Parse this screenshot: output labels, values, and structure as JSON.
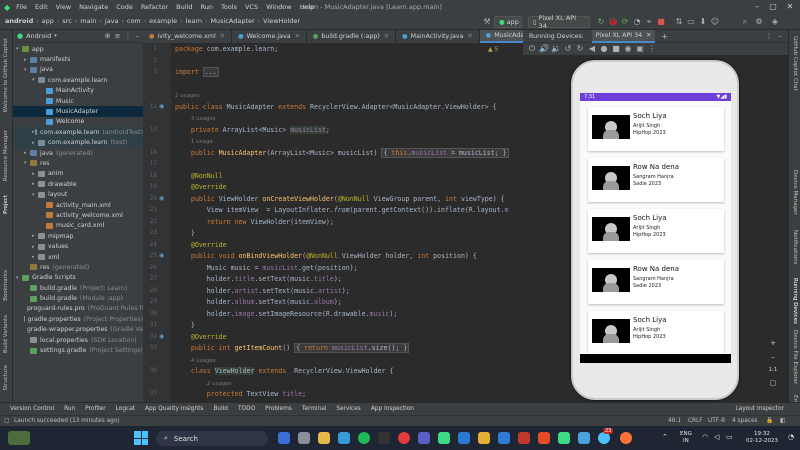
{
  "window": {
    "menu": [
      "File",
      "Edit",
      "View",
      "Navigate",
      "Code",
      "Refactor",
      "Build",
      "Run",
      "Tools",
      "VCS",
      "Window",
      "Help"
    ],
    "title": "Learn - MusicAdapter.java [Learn.app.main]"
  },
  "breadcrumb": [
    "android",
    "app",
    "src",
    "main",
    "java",
    "com",
    "example",
    "learn",
    "MusicAdapter",
    "ViewHolder"
  ],
  "toolbar": {
    "run_config": "app",
    "device": "Pixel XL API 34"
  },
  "project_panel": {
    "view_mode": "Android",
    "tree": [
      {
        "label": "app",
        "depth": 0,
        "arrow": "▾",
        "color": "#6b8f3e"
      },
      {
        "label": "manifests",
        "depth": 1,
        "arrow": "▸",
        "color": "#5c7fa3"
      },
      {
        "label": "java",
        "depth": 1,
        "arrow": "▾",
        "color": "#5c7fa3"
      },
      {
        "label": "com.example.learn",
        "depth": 2,
        "arrow": "▾",
        "color": "#7a8a99"
      },
      {
        "label": "MainActivity",
        "depth": 3,
        "arrow": "",
        "color": "#4a9fd8"
      },
      {
        "label": "Music",
        "depth": 3,
        "arrow": "",
        "color": "#4a9fd8"
      },
      {
        "label": "MusicAdapter",
        "depth": 3,
        "arrow": "",
        "color": "#4a9fd8",
        "selected": true
      },
      {
        "label": "Welcome",
        "depth": 3,
        "arrow": "",
        "color": "#4a9fd8"
      },
      {
        "label": "com.example.learn",
        "suffix": "(androidTest)",
        "depth": 2,
        "arrow": "▸",
        "color": "#7a8a99",
        "highlighted": true
      },
      {
        "label": "com.example.learn",
        "suffix": "(test)",
        "depth": 2,
        "arrow": "▸",
        "color": "#7a8a99",
        "highlighted": true
      },
      {
        "label": "java",
        "suffix": "(generated)",
        "depth": 1,
        "arrow": "▸",
        "color": "#5c7fa3"
      },
      {
        "label": "res",
        "depth": 1,
        "arrow": "▾",
        "color": "#8f7a3e"
      },
      {
        "label": "anim",
        "depth": 2,
        "arrow": "▸",
        "color": "#8f8f8f"
      },
      {
        "label": "drawable",
        "depth": 2,
        "arrow": "▸",
        "color": "#8f8f8f"
      },
      {
        "label": "layout",
        "depth": 2,
        "arrow": "▾",
        "color": "#8f8f8f"
      },
      {
        "label": "activity_main.xml",
        "depth": 3,
        "arrow": "",
        "color": "#c07b3a"
      },
      {
        "label": "activity_welcome.xml",
        "depth": 3,
        "arrow": "",
        "color": "#c07b3a"
      },
      {
        "label": "music_card.xml",
        "depth": 3,
        "arrow": "",
        "color": "#c07b3a"
      },
      {
        "label": "mipmap",
        "depth": 2,
        "arrow": "▸",
        "color": "#8f8f8f"
      },
      {
        "label": "values",
        "depth": 2,
        "arrow": "▸",
        "color": "#8f8f8f"
      },
      {
        "label": "xml",
        "depth": 2,
        "arrow": "▸",
        "color": "#8f8f8f"
      },
      {
        "label": "res",
        "suffix": "(generated)",
        "depth": 1,
        "arrow": "",
        "color": "#8f7a3e"
      },
      {
        "label": "Gradle Scripts",
        "depth": 0,
        "arrow": "▾",
        "color": "#5ca060"
      },
      {
        "label": "build.gradle",
        "suffix": "(Project: Learn)",
        "depth": 1,
        "arrow": "",
        "color": "#5ca060"
      },
      {
        "label": "build.gradle",
        "suffix": "(Module :app)",
        "depth": 1,
        "arrow": "",
        "color": "#5ca060"
      },
      {
        "label": "proguard-rules.pro",
        "suffix": "(ProGuard Rules for \":app\")",
        "depth": 1,
        "arrow": "",
        "color": "#8f8f8f"
      },
      {
        "label": "gradle.properties",
        "suffix": "(Project Properties)",
        "depth": 1,
        "arrow": "",
        "color": "#8f8f8f"
      },
      {
        "label": "gradle-wrapper.properties",
        "suffix": "(Gradle Version)",
        "depth": 1,
        "arrow": "",
        "color": "#8f8f8f"
      },
      {
        "label": "local.properties",
        "suffix": "(SDK Location)",
        "depth": 1,
        "arrow": "",
        "color": "#8f8f8f"
      },
      {
        "label": "settings.gradle",
        "suffix": "(Project Settings)",
        "depth": 1,
        "arrow": "",
        "color": "#5ca060"
      }
    ]
  },
  "editor_tabs": [
    {
      "label": "ivity_welcome.xml",
      "active": false
    },
    {
      "label": "Welcome.java",
      "active": false
    },
    {
      "label": "build.gradle (:app)",
      "active": false
    },
    {
      "label": "MainActivity.java",
      "active": false
    },
    {
      "label": "MusicAdapter.java",
      "active": true
    }
  ],
  "editor": {
    "warnings": "▲ 5",
    "lines": [
      {
        "n": "1",
        "html": "<span class='kw'>package</span> <span class='plain'>com.example.learn;</span>"
      },
      {
        "n": "2",
        "html": ""
      },
      {
        "n": "3",
        "html": "<span class='kw'>import</span> <span class='fold'>...</span>"
      },
      {
        "n": "",
        "html": ""
      },
      {
        "n": "",
        "html": "<span class='usages'>2 usages</span>"
      },
      {
        "n": "12",
        "html": "<span class='kw'>public class</span> <span class='plain'>MusicAdapter</span> <span class='kw'>extends</span> <span class='plain'>RecyclerView.Adapter&lt;MusicAdapter.ViewHolder&gt; {</span>"
      },
      {
        "n": "",
        "html": "    <span class='usages'>3 usages</span>"
      },
      {
        "n": "13",
        "html": "    <span class='kw'>private</span> <span class='plain'>ArrayList&lt;Music&gt;</span> <span class='fld hl-usage'>musicList</span><span class='plain'>;</span>"
      },
      {
        "n": "",
        "html": "    <span class='usages'>1 usage</span>"
      },
      {
        "n": "14",
        "html": "    <span class='kw'>public</span> <span class='fn'>MusicAdapter</span><span class='plain'>(ArrayList&lt;Music&gt; musicList) </span><span class='fold'>{ <span class='kw'>this</span>.<span class='fld'>musicList</span> = musicList; }</span>"
      },
      {
        "n": "17",
        "html": ""
      },
      {
        "n": "18",
        "html": "    <span class='ann'>@NonNull</span>"
      },
      {
        "n": "19",
        "html": "    <span class='ann'>@Override</span>"
      },
      {
        "n": "20",
        "html": "    <span class='kw'>public</span> <span class='plain'>ViewHolder</span> <span class='fn'>onCreateViewHolder</span><span class='plain'>(</span><span class='ann'>@NonNull</span> <span class='plain'>ViewGroup parent, </span><span class='kw'>int</span> <span class='plain'>viewType) {</span>"
      },
      {
        "n": "21",
        "html": "        <span class='plain'>View itemView  = LayoutInflater.</span><span class='plain' style='font-style:italic'>from</span><span class='plain'>(parent.getContext()).inflate(R.layout.</span><span class='fld'>m</span>"
      },
      {
        "n": "22",
        "html": "        <span class='kw'>return new</span> <span class='plain'>ViewHolder(itemView);</span>"
      },
      {
        "n": "23",
        "html": "    <span class='plain'>}</span>"
      },
      {
        "n": "24",
        "html": "    <span class='ann'>@Override</span>"
      },
      {
        "n": "25",
        "html": "    <span class='kw'>public void</span> <span class='fn'>onBindViewHolder</span><span class='plain'>(</span><span class='ann'>@NonNull</span> <span class='plain'>ViewHolder holder, </span><span class='kw'>int</span> <span class='plain'>position) {</span>"
      },
      {
        "n": "26",
        "html": "        <span class='plain'>Music music = </span><span class='fld'>musicList</span><span class='plain'>.get(position);</span>"
      },
      {
        "n": "27",
        "html": "        <span class='plain'>holder.</span><span class='fld'>title</span><span class='plain'>.setText(music.</span><span class='fld'>title</span><span class='plain'>);</span>"
      },
      {
        "n": "28",
        "html": "        <span class='plain'>holder.</span><span class='fld'>artist</span><span class='plain'>.setText(music.</span><span class='fld'>artist</span><span class='plain'>);</span>"
      },
      {
        "n": "29",
        "html": "        <span class='plain'>holder.</span><span class='fld'>album</span><span class='plain'>.setText(music.</span><span class='fld'>album</span><span class='plain'>);</span>"
      },
      {
        "n": "30",
        "html": "        <span class='plain'>holder.</span><span class='fld'>image</span><span class='plain'>.setImageResource(R.drawable.</span><span class='fld'>music</span><span class='plain'>);</span>"
      },
      {
        "n": "31",
        "html": "    <span class='plain'>}</span>"
      },
      {
        "n": "32",
        "html": "    <span class='ann'>@Override</span>"
      },
      {
        "n": "33",
        "html": "    <span class='kw'>public int</span> <span class='fn'>getItemCount</span><span class='plain'>() </span><span class='fold'>{ <span class='kw'>return</span> <span class='fld'>musicList</span>.size(); }</span>"
      },
      {
        "n": "",
        "html": "    <span class='usages'>4 usages</span>"
      },
      {
        "n": "36",
        "html": "    <span class='kw'>class</span> <span class='plain hl-usage'>ViewHolder</span> <span class='kw'>extends</span>  <span class='plain'>RecyclerView.ViewHolder {</span>"
      },
      {
        "n": "",
        "html": "        <span class='usages'>2 usages</span>"
      },
      {
        "n": "37",
        "html": "        <span class='kw'>protected</span> <span class='plain'>TextView</span> <span class='fld'>title</span><span class='plain'>;</span>"
      }
    ]
  },
  "running_devices": {
    "label": "Running Devices:",
    "device_tab": "Pixel XL API 34"
  },
  "phone": {
    "time": "7:31",
    "songs": [
      {
        "title": "Soch Liya",
        "artist": "Arijit Singh",
        "album": "HipHop 2023"
      },
      {
        "title": "Row Na dena",
        "artist": "Sangram Hanjra",
        "album": "Sadie 2023"
      },
      {
        "title": "Soch Liya",
        "artist": "Arijit Singh",
        "album": "HipHop 2023"
      },
      {
        "title": "Row Na dena",
        "artist": "Sangram Hanjra",
        "album": "Sadie 2023"
      },
      {
        "title": "Soch Liya",
        "artist": "Arijit Singh",
        "album": "HipHop 2023"
      }
    ],
    "side_controls": [
      "+",
      "–",
      "1:1"
    ]
  },
  "left_strip": [
    "Welcome to GitHub Copilot",
    "Resource Manager",
    "Project",
    "Bookmarks",
    "Build Variants",
    "Structure"
  ],
  "right_strip": [
    "GitHub Copilot Chat",
    "Device Manager",
    "Notifications",
    "Running Devices",
    "Device File Explorer",
    "Emulator"
  ],
  "bottom_tools": [
    "Version Control",
    "Run",
    "Profiler",
    "Logcat",
    "App Quality Insights",
    "Build",
    "TODO",
    "Problems",
    "Terminal",
    "Services",
    "App Inspection"
  ],
  "layout_inspector": "Layout Inspector",
  "status": {
    "message": "Launch succeeded (13 minutes ago)",
    "position": "48:1",
    "line_sep": "CRLF",
    "encoding": "UTF-8",
    "indent": "4 spaces"
  },
  "taskbar": {
    "search": "Search",
    "lang": "ENG",
    "region": "IN",
    "time": "19:32",
    "date": "02-12-2023",
    "notif_count": "23"
  }
}
